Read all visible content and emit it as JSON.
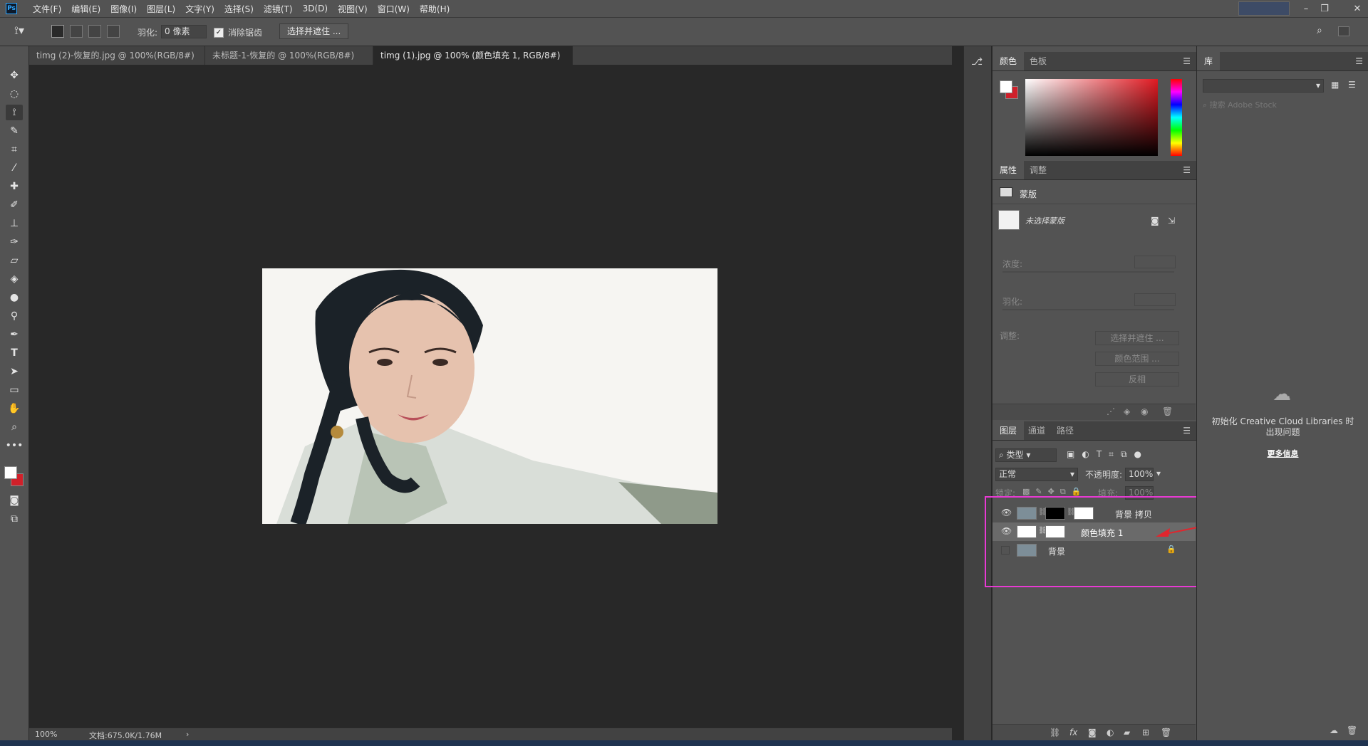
{
  "app": {
    "logo": "Ps"
  },
  "menu": [
    "文件(F)",
    "编辑(E)",
    "图像(I)",
    "图层(L)",
    "文字(Y)",
    "选择(S)",
    "滤镜(T)",
    "3D(D)",
    "视图(V)",
    "窗口(W)",
    "帮助(H)"
  ],
  "options": {
    "feather_label": "羽化:",
    "feather_value": "0 像素",
    "antialias_label": "消除锯齿",
    "antialias_checked": true,
    "select_mask_button": "选择并遮住 ..."
  },
  "tabs": [
    {
      "label": "timg (2)-恢复的.jpg @ 100%(RGB/8#) *",
      "active": false
    },
    {
      "label": "未标题-1-恢复的 @ 100%(RGB/8#) *",
      "active": false
    },
    {
      "label": "timg (1).jpg @ 100% (颜色填充 1, RGB/8#) *",
      "active": true
    }
  ],
  "status": {
    "zoom": "100%",
    "doc": "文档:675.0K/1.76M"
  },
  "color_panel": {
    "tabs": [
      "颜色",
      "色板"
    ],
    "active": "颜色",
    "fg": "#ffffff",
    "bg": "#d0202a"
  },
  "properties_panel": {
    "tabs": [
      "属性",
      "调整"
    ],
    "section": "蒙版",
    "mask_status": "未选择蒙版",
    "density_label": "浓度:",
    "feather_label": "羽化:",
    "adjust_label": "调整:",
    "buttons": [
      "选择并遮住 ...",
      "颜色范围 ...",
      "反相"
    ]
  },
  "layers_panel": {
    "tabs": [
      "图层",
      "通道",
      "路径"
    ],
    "filter_label": "类型",
    "blend_mode": "正常",
    "opacity_label": "不透明度:",
    "opacity_value": "100%",
    "lock_label": "锁定:",
    "fill_label": "填充:",
    "fill_value": "100%",
    "layers": [
      {
        "name": "背景 拷贝",
        "visible": true,
        "locked": false
      },
      {
        "name": "颜色填充 1",
        "visible": true,
        "locked": false,
        "selected": true
      },
      {
        "name": "背景",
        "visible": false,
        "locked": true
      }
    ],
    "footer_icons": [
      "link-icon",
      "fx-icon",
      "add-mask-icon",
      "adjustment-icon",
      "folder-icon",
      "new-layer-icon",
      "trash-icon"
    ]
  },
  "library_panel": {
    "tab": "库",
    "search_placeholder": "搜索 Adobe Stock",
    "error_message": "初始化 Creative Cloud Libraries 时出现问题",
    "more_info": "更多信息"
  },
  "colors": {
    "highlight": "#e83ad4",
    "arrow": "#e0262e"
  }
}
